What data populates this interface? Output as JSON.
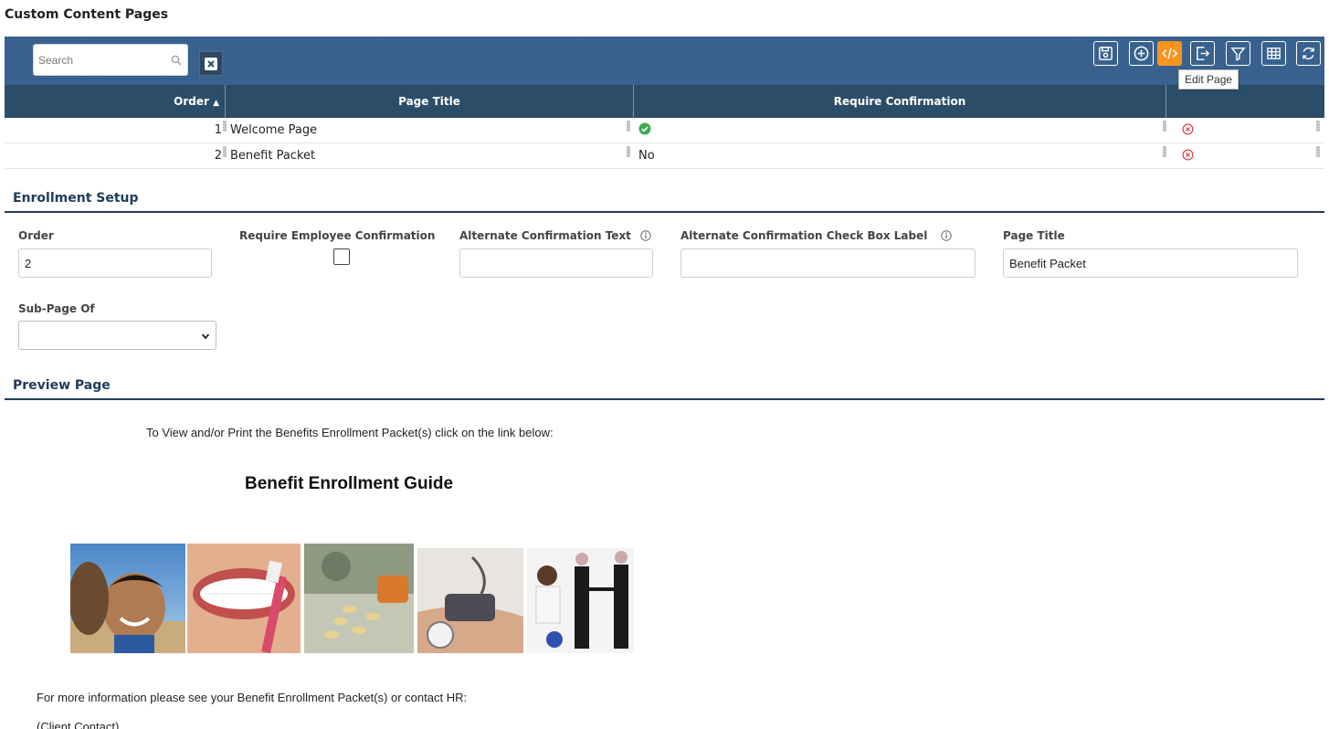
{
  "page": {
    "title": "Custom Content Pages"
  },
  "toolbar": {
    "search_placeholder": "Search",
    "buttons": [
      {
        "name": "save",
        "icon": "save-icon"
      },
      {
        "name": "add",
        "icon": "plus-circle-icon"
      },
      {
        "name": "edit-page",
        "icon": "code-icon",
        "active": true
      },
      {
        "name": "export",
        "icon": "export-icon"
      },
      {
        "name": "filter",
        "icon": "filter-icon"
      },
      {
        "name": "columns",
        "icon": "table-icon"
      },
      {
        "name": "refresh",
        "icon": "refresh-icon"
      }
    ],
    "tooltip": "Edit Page",
    "accent_color": "#f7941d",
    "bar_color": "#3b6594"
  },
  "grid": {
    "columns": [
      "Order",
      "Page Title",
      "Require Confirmation"
    ],
    "sort_indicator": "▲",
    "rows": [
      {
        "order": "1",
        "title": "Welcome Page",
        "confirm": "",
        "confirm_icon": "check-circle-icon"
      },
      {
        "order": "2",
        "title": "Benefit Packet",
        "confirm": "No",
        "confirm_icon": ""
      }
    ]
  },
  "setup": {
    "title": "Enrollment Setup",
    "order_label": "Order",
    "order_value": "2",
    "require_label": "Require Employee Confirmation",
    "alt_text_label": "Alternate Confirmation Text",
    "alt_check_label": "Alternate Confirmation Check Box Label",
    "page_title_label": "Page Title",
    "page_title_value": "Benefit Packet",
    "subpage_label": "Sub-Page Of"
  },
  "preview": {
    "title": "Preview Page",
    "intro": "To View and/or Print the Benefits Enrollment Packet(s) click on the link below:",
    "guide_title": "Benefit Enrollment Guide",
    "footer": "For more information please see your Benefit Enrollment Packet(s) or contact HR:",
    "contact": "(Client Contact)"
  }
}
